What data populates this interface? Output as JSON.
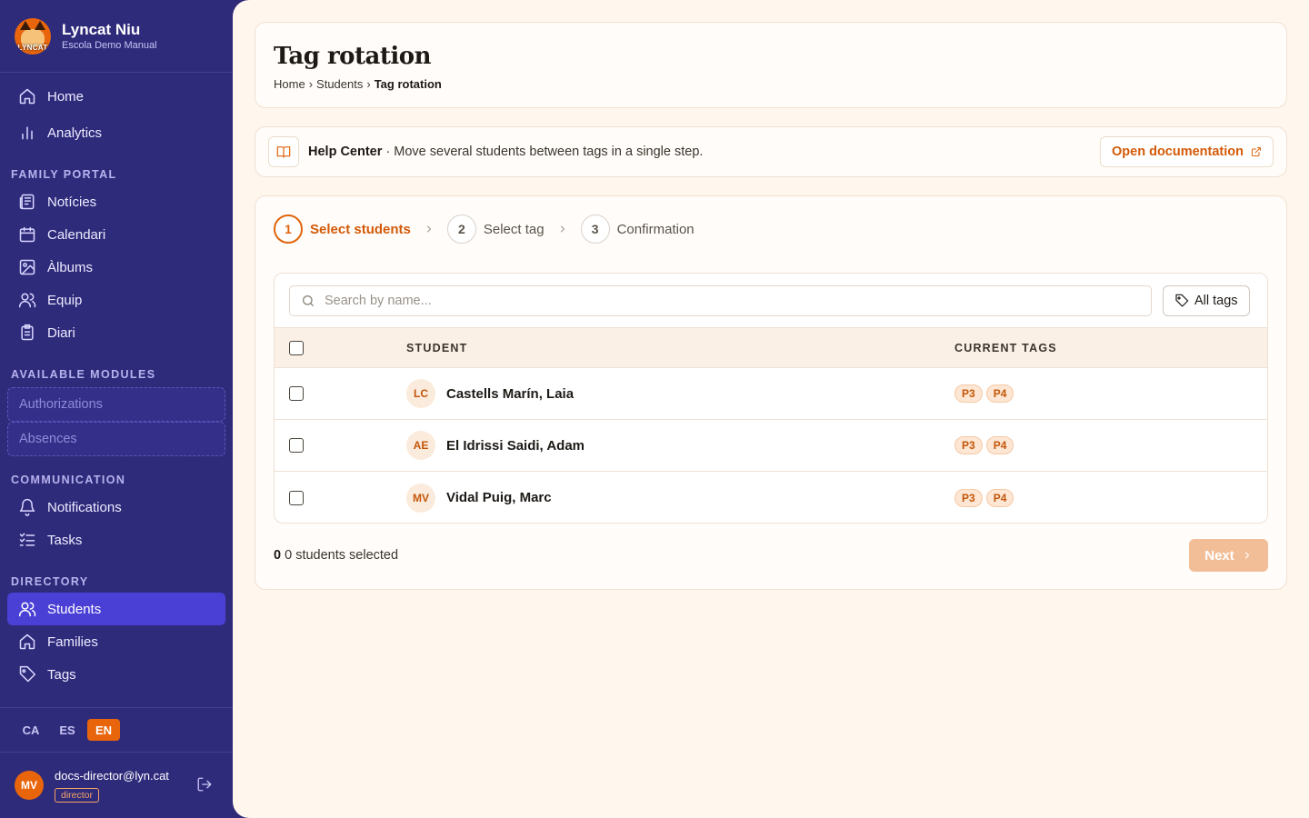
{
  "brand": {
    "title": "Lyncat Niu",
    "subtitle": "Escola Demo Manual",
    "logo_text": "LYNCAT"
  },
  "sidebar": {
    "top_items": [
      {
        "label": "Home",
        "icon": "home-icon"
      },
      {
        "label": "Analytics",
        "icon": "bar-chart-icon"
      }
    ],
    "sections": {
      "family_portal": {
        "title": "FAMILY PORTAL",
        "items": [
          {
            "label": "Notícies",
            "icon": "newspaper-icon"
          },
          {
            "label": "Calendari",
            "icon": "calendar-icon"
          },
          {
            "label": "Àlbums",
            "icon": "image-icon"
          },
          {
            "label": "Equip",
            "icon": "users-icon"
          },
          {
            "label": "Diari",
            "icon": "clipboard-icon"
          }
        ]
      },
      "available_modules": {
        "title": "AVAILABLE MODULES",
        "items": [
          {
            "label": "Authorizations"
          },
          {
            "label": "Absences"
          }
        ]
      },
      "communication": {
        "title": "COMMUNICATION",
        "items": [
          {
            "label": "Notifications",
            "icon": "bell-icon"
          },
          {
            "label": "Tasks",
            "icon": "checklist-icon"
          }
        ]
      },
      "directory": {
        "title": "DIRECTORY",
        "items": [
          {
            "label": "Students",
            "icon": "users-icon",
            "active": true
          },
          {
            "label": "Families",
            "icon": "home-icon"
          },
          {
            "label": "Tags",
            "icon": "tag-icon"
          }
        ]
      }
    }
  },
  "languages": {
    "ca": "CA",
    "es": "ES",
    "en": "EN",
    "active": "EN"
  },
  "user": {
    "initials": "MV",
    "email": "docs-director@lyn.cat",
    "role": "director"
  },
  "header": {
    "title": "Tag rotation",
    "breadcrumb": {
      "home": "Home",
      "sep": "›",
      "students": "Students",
      "current": "Tag rotation"
    }
  },
  "help": {
    "title": "Help Center",
    "text": " · Move several students between tags in a single step.",
    "doc_button": "Open documentation"
  },
  "wizard": {
    "steps": [
      {
        "num": "1",
        "label": "Select students",
        "active": true
      },
      {
        "num": "2",
        "label": "Select tag"
      },
      {
        "num": "3",
        "label": "Confirmation"
      }
    ],
    "search_placeholder": "Search by name...",
    "tags_filter": "All tags",
    "columns": {
      "student": "STUDENT",
      "current_tags": "CURRENT TAGS"
    },
    "rows": [
      {
        "initials": "LC",
        "name": "Castells Marín, Laia",
        "tags": [
          "P3",
          "P4"
        ]
      },
      {
        "initials": "AE",
        "name": "El Idrissi Saidi, Adam",
        "tags": [
          "P3",
          "P4"
        ]
      },
      {
        "initials": "MV",
        "name": "Vidal Puig, Marc",
        "tags": [
          "P3",
          "P4"
        ]
      }
    ],
    "selected_count": "0",
    "selected_text": "0 students selected",
    "next_button": "Next"
  },
  "colors": {
    "sidebar": "#2f2b7b",
    "accent": "#e0640c",
    "active_nav": "#4a40d6",
    "background": "#fff6ee"
  }
}
